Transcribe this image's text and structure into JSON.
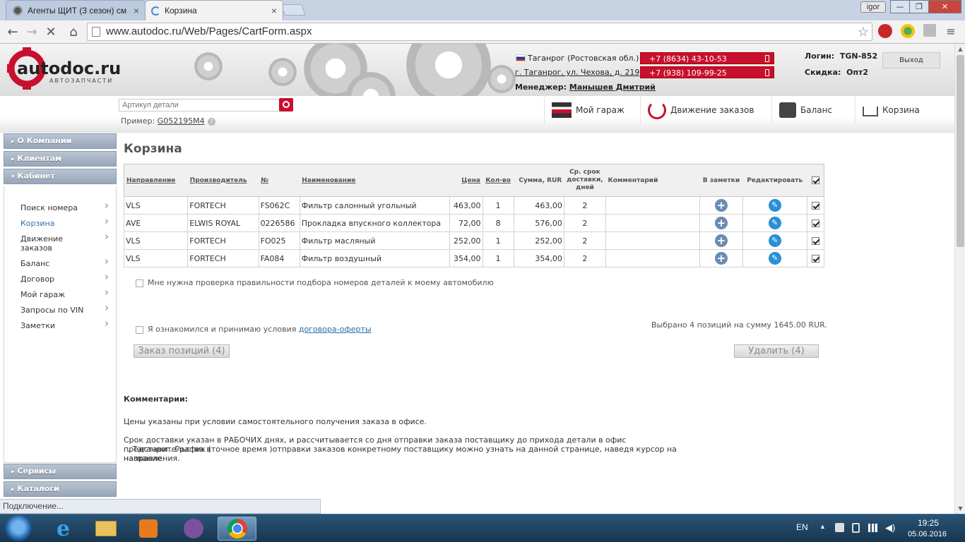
{
  "browser": {
    "tabs": [
      {
        "label": "Агенты ЩИТ (3 сезон) см",
        "active": false
      },
      {
        "label": "Корзина",
        "active": true
      }
    ],
    "profile": "igor",
    "url": "www.autodoc.ru/Web/Pages/CartForm.aspx",
    "status": "Подключение..."
  },
  "header": {
    "city": "Таганрог (Ростовская обл.)",
    "address": "г. Таганрог, ул. Чехова, д. 219",
    "manager_label": "Менеджер:",
    "manager_name": "Манышев Дмитрий",
    "phone1": "+7 (8634) 43-10-53",
    "phone2": "+7 (938) 109-99-25",
    "login_label": "Логин:",
    "login_value": "TGN-852",
    "discount_label": "Скидка:",
    "discount_value": "Опт2",
    "exit": "Выход",
    "logo_text": "autodoc.ru",
    "logo_sub": "АВТОЗАПЧАСТИ"
  },
  "search": {
    "placeholder": "Артикул детали",
    "example_label": "Пример:",
    "example_value": "G052195M4"
  },
  "nav": [
    "Мой гараж",
    "Движение заказов",
    "Баланс",
    "Корзина"
  ],
  "sidebar": {
    "sections": [
      "О Компании",
      "Клиентам",
      "Кабинет"
    ],
    "items": [
      "Поиск номера",
      "Корзина",
      "Движение заказов",
      "Баланс",
      "Договор",
      "Мой гараж",
      "Запросы по VIN",
      "Заметки"
    ],
    "active_item": "Корзина",
    "bottom_sections": [
      "Сервисы",
      "Каталоги"
    ]
  },
  "page": {
    "title": "Корзина"
  },
  "cart": {
    "columns": [
      "Направление",
      "Производитель",
      "№",
      "Наименование",
      "Цена",
      "Кол-во",
      "Сумма, RUR",
      "Ср. срок доставки, дней",
      "Комментарий",
      "В заметки",
      "Редактировать"
    ],
    "rows": [
      {
        "direction": "VLS",
        "maker": "FORTECH",
        "number": "FS062C",
        "name": "Фильтр салонный угольный",
        "price": "463,00",
        "qty": "1",
        "sum": "463,00",
        "days": "2",
        "comment": "",
        "checked": true
      },
      {
        "direction": "AVE",
        "maker": "ELWIS ROYAL",
        "number": "0226586",
        "name": "Прокладка впускного коллектора",
        "price": "72,00",
        "qty": "8",
        "sum": "576,00",
        "days": "2",
        "comment": "",
        "checked": true
      },
      {
        "direction": "VLS",
        "maker": "FORTECH",
        "number": "FO025",
        "name": "Фильтр масляный",
        "price": "252,00",
        "qty": "1",
        "sum": "252,00",
        "days": "2",
        "comment": "",
        "checked": true
      },
      {
        "direction": "VLS",
        "maker": "FORTECH",
        "number": "FA084",
        "name": "Фильтр воздушный",
        "price": "354,00",
        "qty": "1",
        "sum": "354,00",
        "days": "2",
        "comment": "",
        "checked": true
      }
    ],
    "check_numbers": "Мне нужна проверка правильности подбора номеров деталей к моему автомобилю",
    "agree_text": "Я ознакомился и принимаю условия",
    "agree_link": "договора-оферты",
    "summary": "Выбрано 4 позиций на сумму 1645.00 RUR.",
    "order_btn": "Заказ позиций (4)",
    "delete_btn": "Удалить (4)"
  },
  "comments": {
    "title": "Комментарии:",
    "p1": "Цены указаны при условии самостоятельного получения заказа в офисе.",
    "p2a": "Срок доставки указан в РАБОЧИХ днях, и рассчитывается со дня отправки заказа поставщику до прихода детали в офис представительства в",
    "p2b": "г. Таганрог. График (точное время )отправки заказов конкретному поставщику можно узнать на данной странице, наведя курсор на название",
    "p2c": "направления."
  },
  "taskbar": {
    "lang": "EN",
    "time": "19:25",
    "date": "05.06.2016"
  },
  "colors": {
    "brand_red": "#c8102e",
    "link_blue": "#2b6aa6",
    "sidebar_head": "#98a6b8"
  }
}
